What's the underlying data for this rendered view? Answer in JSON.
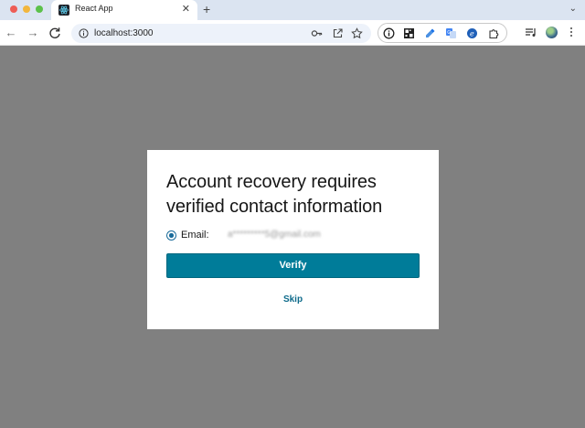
{
  "browser": {
    "tab": {
      "title": "React App"
    },
    "new_tab_label": "+",
    "tab_menu_label": "⌄",
    "url": "localhost:3000"
  },
  "modal": {
    "title": "Account recovery requires verified contact information",
    "email_option": {
      "label": "Email:",
      "value_obscured": "a*********5@gmail.com",
      "selected": true
    },
    "verify_label": "Verify",
    "skip_label": "Skip"
  },
  "colors": {
    "overlay": "#808080",
    "primary_button": "#007c99",
    "link": "#0d6a8a"
  },
  "icons": {
    "tab_favicon": "react-icon",
    "toolbar": [
      "back-arrow-icon",
      "forward-arrow-icon",
      "reload-icon",
      "site-info-icon",
      "password-key-icon",
      "open-external-icon",
      "bookmark-star-icon"
    ],
    "extensions": [
      "ext-info-icon",
      "ext-grid-icon",
      "ext-dropper-icon",
      "ext-translate-icon",
      "ext-e-icon",
      "puzzle-icon"
    ],
    "right": [
      "media-queue-icon",
      "profile-avatar",
      "kebab-menu-icon"
    ]
  }
}
